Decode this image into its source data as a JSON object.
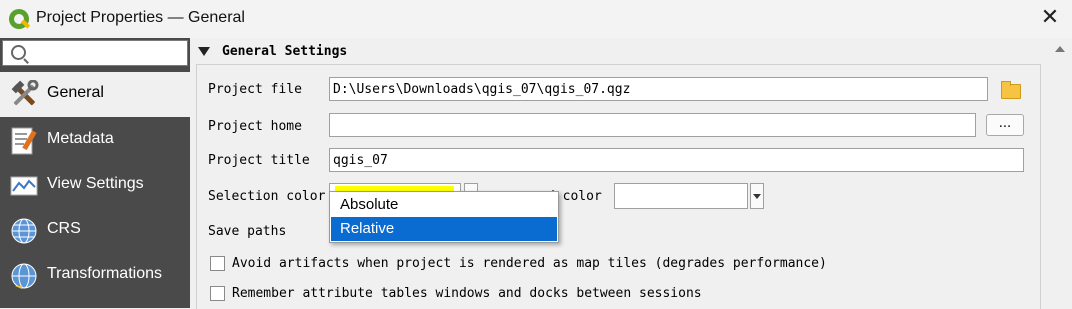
{
  "window": {
    "title": "Project Properties — General",
    "close_icon": "close-icon"
  },
  "sidebar": {
    "search_placeholder": "",
    "items": [
      {
        "label": "General",
        "icon": "hammer-wrench-icon",
        "active": true
      },
      {
        "label": "Metadata",
        "icon": "document-edit-icon"
      },
      {
        "label": "View Settings",
        "icon": "map-view-icon"
      },
      {
        "label": "CRS",
        "icon": "globe-icon"
      },
      {
        "label": "Transformations",
        "icon": "globe-transform-icon"
      }
    ]
  },
  "section": {
    "title": "General Settings"
  },
  "form": {
    "project_file_label": "Project file",
    "project_file_value": "D:\\Users\\Downloads\\qgis_07\\qgis_07.qgz",
    "project_home_label": "Project home",
    "project_home_value": "",
    "browse_label": "...",
    "project_title_label": "Project title",
    "project_title_value": "qgis_07",
    "selection_color_label": "Selection color",
    "background_color_label_visible": "d color",
    "save_paths_label": "Save paths",
    "avoid_artifacts_label": "Avoid artifacts when project is rendered as map tiles (degrades performance)",
    "remember_tables_label": "Remember attribute tables windows and docks between sessions"
  },
  "save_paths_popup": {
    "options": [
      "Absolute",
      "Relative"
    ],
    "selected": "Relative"
  },
  "colors": {
    "selection": "#ffff00",
    "accent": "#0a6bd1",
    "sidebar_bg": "#4a4a4a"
  }
}
